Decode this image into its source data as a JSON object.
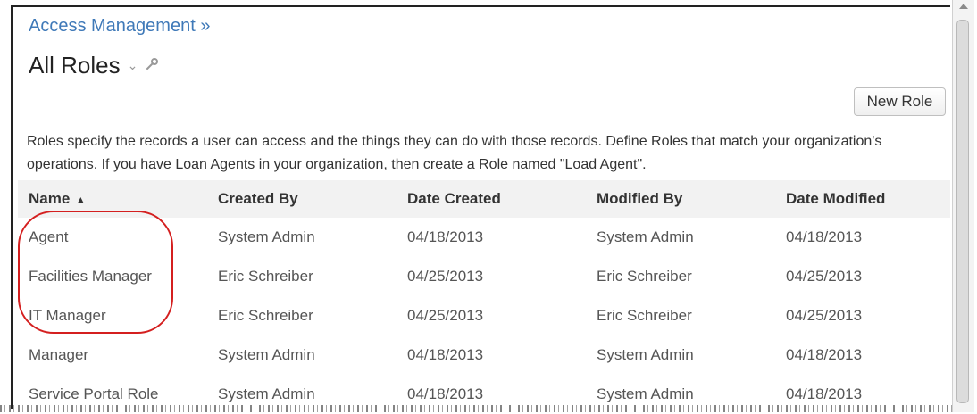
{
  "header": {
    "breadcrumb": "Access Management »",
    "title": "All Roles",
    "title_chevron": "⌄",
    "wrench_icon": "wrench-icon"
  },
  "toolbar": {
    "new_role_label": "New Role"
  },
  "description": "Roles specify the records a user can access and the things they can do with those records. Define Roles that match your organization's operations. If you have Loan Agents in your organization, then create a Role named \"Load Agent\".",
  "table": {
    "columns": [
      "Name",
      "Created By",
      "Date Created",
      "Modified By",
      "Date Modified"
    ],
    "sort_indicator": "▲",
    "rows": [
      [
        "Agent",
        "System Admin",
        "04/18/2013",
        "System Admin",
        "04/18/2013"
      ],
      [
        "Facilities Manager",
        "Eric Schreiber",
        "04/25/2013",
        "Eric Schreiber",
        "04/25/2013"
      ],
      [
        "IT Manager",
        "Eric Schreiber",
        "04/25/2013",
        "Eric Schreiber",
        "04/25/2013"
      ],
      [
        "Manager",
        "System Admin",
        "04/18/2013",
        "System Admin",
        "04/18/2013"
      ],
      [
        "Service Portal Role",
        "System Admin",
        "04/18/2013",
        "System Admin",
        "04/18/2013"
      ]
    ]
  },
  "annotation": {
    "highlight_color": "#d41f1f"
  }
}
